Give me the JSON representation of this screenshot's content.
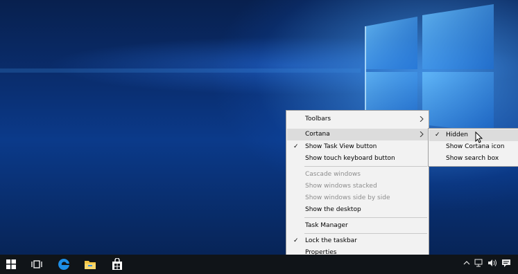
{
  "context_menu": {
    "items": [
      {
        "label": "Toolbars"
      },
      {
        "label": "Cortana"
      },
      {
        "label": "Show Task View button"
      },
      {
        "label": "Show touch keyboard button"
      },
      {
        "label": "Cascade windows"
      },
      {
        "label": "Show windows stacked"
      },
      {
        "label": "Show windows side by side"
      },
      {
        "label": "Show the desktop"
      },
      {
        "label": "Task Manager"
      },
      {
        "label": "Lock the taskbar"
      },
      {
        "label": "Properties"
      }
    ],
    "check_glyph": "✓"
  },
  "cortana_submenu": {
    "items": [
      {
        "label": "Hidden"
      },
      {
        "label": "Show Cortana icon"
      },
      {
        "label": "Show search box"
      }
    ]
  },
  "taskbar": {
    "pinned": [
      "windows-logo-icon",
      "task-view-icon",
      "edge-icon",
      "file-explorer-icon",
      "store-icon"
    ],
    "tray": [
      "chevron-up-icon",
      "network-icon",
      "volume-icon",
      "action-center-icon"
    ]
  },
  "colors": {
    "desktop_blue": "#0b3a8a",
    "logo_light": "#7fd0ff",
    "taskbar": "#101418",
    "menu_bg": "#f2f2f2",
    "menu_highlight": "#dcdcdc",
    "disabled_text": "#8d8d8d",
    "edge_blue": "#1e8fe8"
  }
}
